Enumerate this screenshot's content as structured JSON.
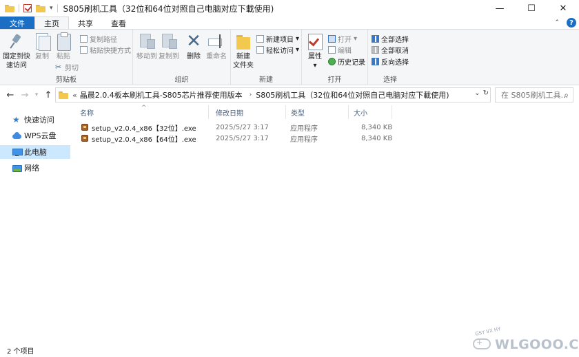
{
  "window": {
    "title": "S805刷机工具（32位和64位对照自己电脑对应下載使用)",
    "minimize": "—",
    "maximize": "☐",
    "close": "✕"
  },
  "ribbon_tabs": [
    "文件",
    "主页",
    "共享",
    "查看"
  ],
  "ribbon": {
    "clipboard": {
      "pin_label_1": "固定到快",
      "pin_label_2": "速访问",
      "copy": "复制",
      "paste": "粘贴",
      "copy_path": "复制路径",
      "paste_shortcut": "粘贴快捷方式",
      "cut": "剪切",
      "group": "剪贴板"
    },
    "organize": {
      "move_to": "移动到",
      "copy_to": "复制到",
      "delete": "删除",
      "rename": "重命名",
      "group": "组织"
    },
    "new": {
      "new_folder_1": "新建",
      "new_folder_2": "文件夹",
      "new_item": "新建项目",
      "easy_access": "轻松访问",
      "group": "新建"
    },
    "open": {
      "properties": "属性",
      "open": "打开",
      "edit": "编辑",
      "history": "历史记录",
      "group": "打开"
    },
    "select": {
      "select_all": "全部选择",
      "select_none": "全部取消",
      "invert": "反向选择",
      "group": "选择"
    }
  },
  "address": {
    "overflow": "«",
    "crumbs": [
      "晶晨2.0.4板本刷机工具-S805芯片推荐使用版本",
      "S805刷机工具（32位和64位对照自己电脑对应下載使用)"
    ],
    "search_placeholder": "在 S805刷机工具..."
  },
  "sidebar": {
    "items": [
      {
        "label": "快速访问",
        "icon": "star-icon"
      },
      {
        "label": "WPS云盘",
        "icon": "cloud-icon"
      },
      {
        "label": "此电脑",
        "icon": "pc-icon",
        "selected": true
      },
      {
        "label": "网络",
        "icon": "network-icon"
      }
    ]
  },
  "columns": [
    "名称",
    "修改日期",
    "类型",
    "大小"
  ],
  "files": [
    {
      "name": "setup_v2.0.4_x86【32位】.exe",
      "date": "2025/5/27 3:17",
      "type": "应用程序",
      "size": "8,340 KB"
    },
    {
      "name": "setup_v2.0.4_x86【64位】.exe",
      "date": "2025/5/27 3:17",
      "type": "应用程序",
      "size": "8,340 KB"
    }
  ],
  "status": {
    "count": "2 个项目"
  },
  "watermark": {
    "text": "WLGOOO.COM",
    "small": "GSY VX HY"
  }
}
